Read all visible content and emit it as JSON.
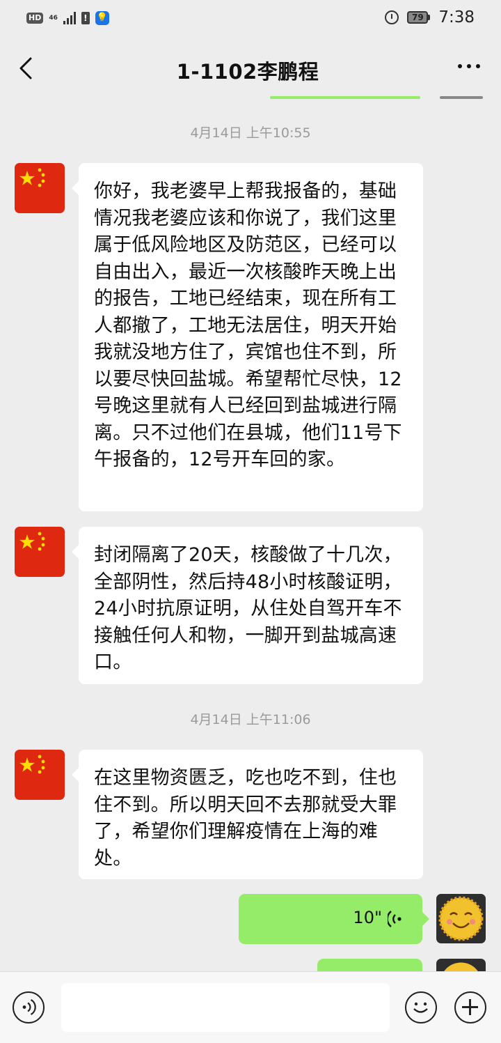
{
  "status_bar": {
    "hd": "HD",
    "network": "46",
    "battery": "79",
    "time": "7:38"
  },
  "nav": {
    "title": "1-1102李鹏程"
  },
  "messages": [
    {
      "timestamp": "4月14日 上午10:55",
      "text": "你好，我老婆早上帮我报备的，基础情况我老婆应该和你说了，我们这里属于低风险地区及防范区，已经可以自由出入，最近一次核酸昨天晚上出的报告，工地已经结束，现在所有工人都撤了，工地无法居住，明天开始我就没地方住了，宾馆也住不到，所以要尽快回盐城。希望帮忙尽快，12号晚这里就有人已经回到盐城进行隔离。只不过他们在县城，他们11号下午报备的，12号开车回的家。"
    },
    {
      "text": "封闭隔离了20天，核酸做了十几次，全部阴性，然后持48小时核酸证明，24小时抗原证明，从住处自驾开车不接触任何人和物，一脚开到盐城高速口。"
    },
    {
      "timestamp": "4月14日 上午11:06",
      "text": "在这里物资匮乏，吃也吃不到，住也住不到。所以明天回不去那就受大罪了，希望你们理解疫情在上海的难处。"
    }
  ],
  "voice_message": {
    "duration": "10\""
  },
  "colors": {
    "background": "#ededed",
    "bubble_incoming": "#ffffff",
    "bubble_outgoing": "#95ec69",
    "timestamp": "#9a9a9a"
  },
  "icons": [
    "back-icon",
    "more-icon",
    "voice-input-icon",
    "emoji-icon",
    "plus-icon",
    "voice-wave-icon"
  ]
}
